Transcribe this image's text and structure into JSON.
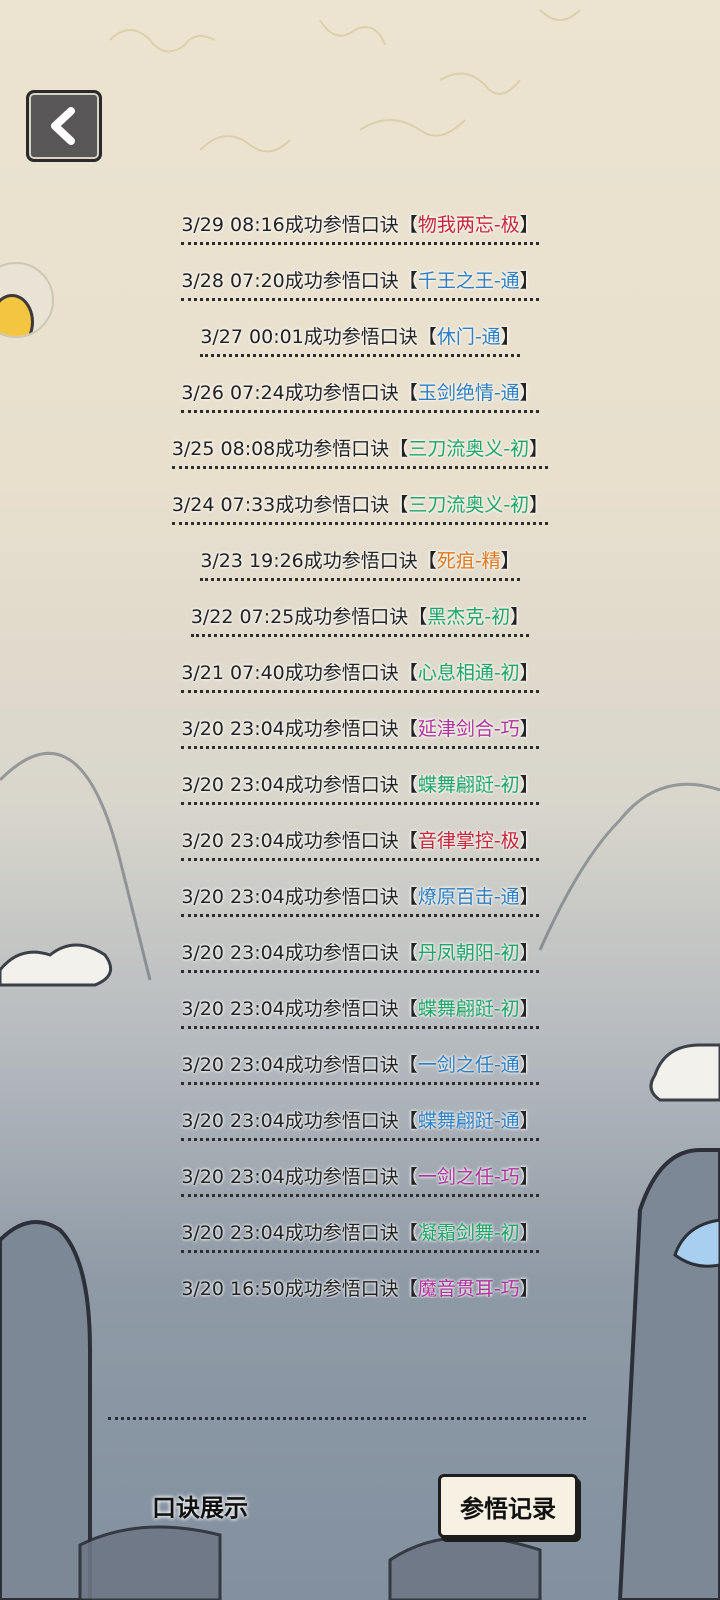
{
  "colors": {
    "red": "#c8263a",
    "blue": "#2f7fc2",
    "green": "#1fa567",
    "orange": "#e0781c",
    "purple": "#b0349b"
  },
  "header": {
    "back_icon": "chevron-left-icon"
  },
  "records": [
    {
      "time": "3/29 08:16",
      "text": "成功参悟口诀",
      "open": "【",
      "skill": "物我两忘-极",
      "close": "】",
      "color": "red"
    },
    {
      "time": "3/28 07:20",
      "text": "成功参悟口诀",
      "open": "【",
      "skill": "千王之王-通",
      "close": "】",
      "color": "blue"
    },
    {
      "time": "3/27 00:01",
      "text": "成功参悟口诀",
      "open": "【",
      "skill": "休门-通",
      "close": "】",
      "color": "blue"
    },
    {
      "time": "3/26 07:24",
      "text": "成功参悟口诀",
      "open": "【",
      "skill": "玉剑绝情-通",
      "close": "】",
      "color": "blue"
    },
    {
      "time": "3/25 08:08",
      "text": "成功参悟口诀",
      "open": "【",
      "skill": "三刀流奥义-初",
      "close": "】",
      "color": "green"
    },
    {
      "time": "3/24 07:33",
      "text": "成功参悟口诀",
      "open": "【",
      "skill": "三刀流奥义-初",
      "close": "】",
      "color": "green"
    },
    {
      "time": "3/23 19:26",
      "text": "成功参悟口诀",
      "open": "【",
      "skill": "死疽-精",
      "close": "】",
      "color": "orange"
    },
    {
      "time": "3/22 07:25",
      "text": "成功参悟口诀",
      "open": "【",
      "skill": "黑杰克-初",
      "close": "】",
      "color": "green"
    },
    {
      "time": "3/21 07:40",
      "text": "成功参悟口诀",
      "open": "【",
      "skill": "心息相通-初",
      "close": "】",
      "color": "green"
    },
    {
      "time": "3/20 23:04",
      "text": "成功参悟口诀",
      "open": "【",
      "skill": "延津剑合-巧",
      "close": "】",
      "color": "purple"
    },
    {
      "time": "3/20 23:04",
      "text": "成功参悟口诀",
      "open": "【",
      "skill": "蝶舞翩跹-初",
      "close": "】",
      "color": "green"
    },
    {
      "time": "3/20 23:04",
      "text": "成功参悟口诀",
      "open": "【",
      "skill": "音律掌控-极",
      "close": "】",
      "color": "red"
    },
    {
      "time": "3/20 23:04",
      "text": "成功参悟口诀",
      "open": "【",
      "skill": "燎原百击-通",
      "close": "】",
      "color": "blue"
    },
    {
      "time": "3/20 23:04",
      "text": "成功参悟口诀",
      "open": "【",
      "skill": "丹凤朝阳-初",
      "close": "】",
      "color": "green"
    },
    {
      "time": "3/20 23:04",
      "text": "成功参悟口诀",
      "open": "【",
      "skill": "蝶舞翩跹-初",
      "close": "】",
      "color": "green"
    },
    {
      "time": "3/20 23:04",
      "text": "成功参悟口诀",
      "open": "【",
      "skill": "一剑之任-通",
      "close": "】",
      "color": "blue"
    },
    {
      "time": "3/20 23:04",
      "text": "成功参悟口诀",
      "open": "【",
      "skill": "蝶舞翩跹-通",
      "close": "】",
      "color": "blue"
    },
    {
      "time": "3/20 23:04",
      "text": "成功参悟口诀",
      "open": "【",
      "skill": "一剑之任-巧",
      "close": "】",
      "color": "purple"
    },
    {
      "time": "3/20 23:04",
      "text": "成功参悟口诀",
      "open": "【",
      "skill": "凝霜剑舞-初",
      "close": "】",
      "color": "green"
    },
    {
      "time": "3/20 16:50",
      "text": "成功参悟口诀",
      "open": "【",
      "skill": "魔音贯耳-巧",
      "close": "】",
      "color": "purple"
    }
  ],
  "tabs": {
    "display_label": "口诀展示",
    "record_label": "参悟记录"
  }
}
